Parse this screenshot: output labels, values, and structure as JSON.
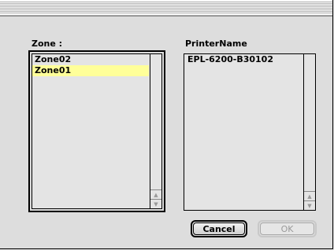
{
  "zone": {
    "label": "Zone :",
    "items": [
      {
        "label": "Zone02",
        "selected": false
      },
      {
        "label": "Zone01",
        "selected": true
      }
    ]
  },
  "printer": {
    "label": "PrinterName",
    "items": [
      {
        "label": "EPL-6200-B30102"
      }
    ]
  },
  "buttons": {
    "cancel": "Cancel",
    "ok": "OK"
  },
  "colors": {
    "selection": "#ffff99",
    "background": "#dddddd"
  }
}
